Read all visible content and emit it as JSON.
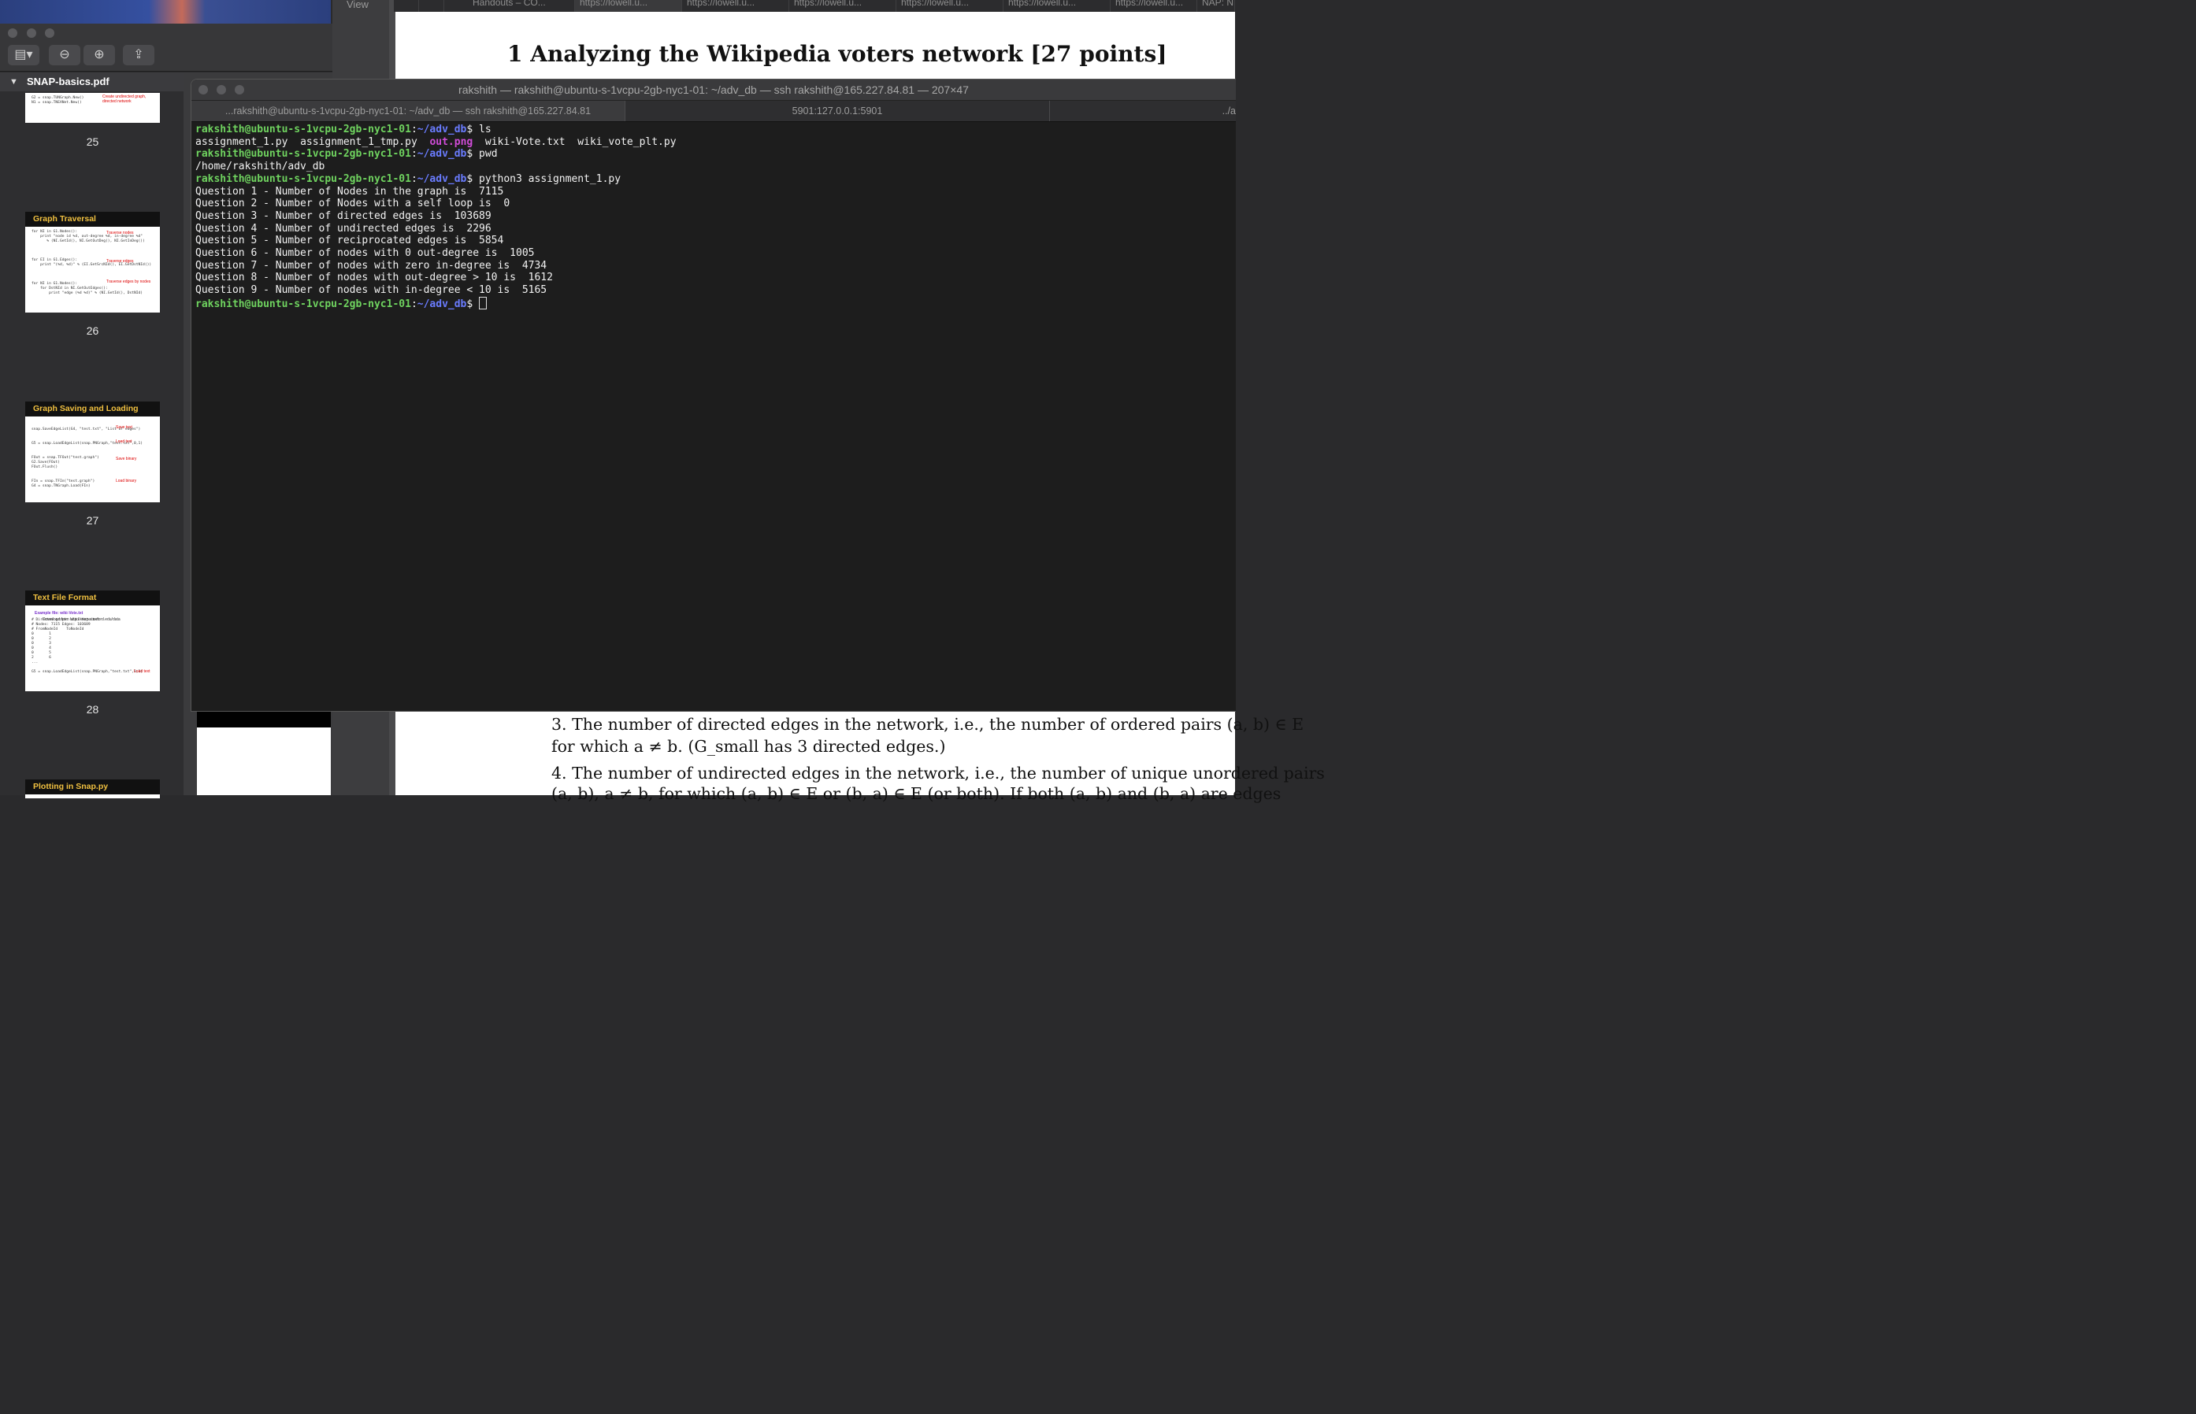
{
  "preview": {
    "filename": "SNAP-basics.pdf",
    "thumbnails": [
      {
        "page": "25",
        "title": "",
        "code": "G2 = snap.TUNGraph.New()\nN1 = snap.TNEANet.New()",
        "notes": [
          "Create undirected graph,",
          "directed network"
        ]
      },
      {
        "page": "26",
        "title": "Graph Traversal",
        "code": "for NI in G1.Nodes():\n    print \"node id %d, out-degree %d, in-degree %d\"\n       % (NI.GetId(), NI.GetOutDeg(), NI.GetInDeg())\n\n\n\nfor EI in G1.Edges():\n    print \"(%d, %d)\" % (EI.GetSrcNId(), EI.GetDstNId())\n\n\n\nfor NI in G1.Nodes():\n    for DstNId in NI.GetOutEdges():\n        print \"edge (%d %d)\" % (NI.GetId(), DstNId)",
        "notes": [
          "Traverse nodes",
          "Traverse edges",
          "Traverse edges by nodes"
        ]
      },
      {
        "page": "27",
        "title": "Graph Saving and Loading",
        "code": "snap.SaveEdgeList(G4, \"test.txt\", \"List of edges\")\n\n\nG5 = snap.LoadEdgeList(snap.PNGraph,\"test.txt\",0,1)\n\n\nFOut = snap.TFOut(\"test.graph\")\nG2.Save(FOut)\nFOut.Flush()\n\n\nFIn = snap.TFIn(\"test.graph\")\nG4 = snap.TNGraph.Load(FIn)",
        "notes": [
          "Save text",
          "Load text",
          "Save binary",
          "Load binary"
        ]
      },
      {
        "page": "28",
        "title": "Text File Format",
        "code": "\n\n# Directed graph: wiki-Vote.txt\n# Nodes: 7115 Edges: 103689\n# FromNodeId    ToNodeId\n0       1\n0       2\n0       3\n0       4\n0       5\n2       6\n...\n\nG5 = snap.LoadEdgeList(snap.PNGraph,\"test.txt\",0,1)",
        "notes": [
          "Example file: wiki-Vote.txt",
          "Download from http://snap.stanford.edu/data",
          "Load text"
        ]
      },
      {
        "page": "",
        "title": "Plotting in Snap.py",
        "code": "",
        "notes": []
      }
    ]
  },
  "browser": {
    "side_label": "View",
    "tabs": [
      "Handouts – CO...",
      "https://lowell.u...",
      "https://lowell.u...",
      "https://lowell.u...",
      "https://lowell.u...",
      "https://lowell.u...",
      "https://lowell.u...",
      "NAP: N"
    ],
    "heading": "1   Analyzing the Wikipedia voters network [27 points]",
    "items": [
      "3.  The number of directed edges in the network, i.e., the number of ordered pairs (a, b) ∈ E",
      "     for which a ≠ b. (G_small has 3 directed edges.)",
      "4.  The number of undirected edges in the network, i.e., the number of unique unordered pairs",
      "     (a, b), a ≠ b, for which (a, b) ∈ E or (b, a) ∈ E (or both). If both (a, b) and (b, a) are edges"
    ]
  },
  "terminal": {
    "title": "rakshith — rakshith@ubuntu-s-1vcpu-2gb-nyc1-01: ~/adv_db — ssh rakshith@165.227.84.81 — 207×47",
    "tabs": [
      "...rakshith@ubuntu-s-1vcpu-2gb-nyc1-01: ~/adv_db — ssh rakshith@165.227.84.81",
      "5901:127.0.0.1:5901",
      "../a"
    ],
    "prompt_user": "rakshith@ubuntu-s-1vcpu-2gb-nyc1-01",
    "prompt_path": "~/adv_db",
    "commands": [
      "ls",
      "pwd",
      "python3 assignment_1.py"
    ],
    "ls_output": [
      "assignment_1.py",
      "assignment_1_tmp.py",
      "out.png",
      "wiki-Vote.txt",
      "wiki_vote_plt.py"
    ],
    "pwd_output": "/home/rakshith/adv_db",
    "questions": [
      "Question 1 - Number of Nodes in the graph is  7115",
      "Question 2 - Number of Nodes with a self loop is  0",
      "Question 3 - Number of directed edges is  103689",
      "Question 4 - Number of undirected edges is  2296",
      "Question 5 - Number of reciprocated edges is  5854",
      "Question 6 - Number of nodes with 0 out-degree is  1005",
      "Question 7 - Number of nodes with zero in-degree is  4734",
      "Question 8 - Number of nodes with out-degree > 10 is  1612",
      "Question 9 - Number of nodes with in-degree < 10 is  5165"
    ]
  }
}
